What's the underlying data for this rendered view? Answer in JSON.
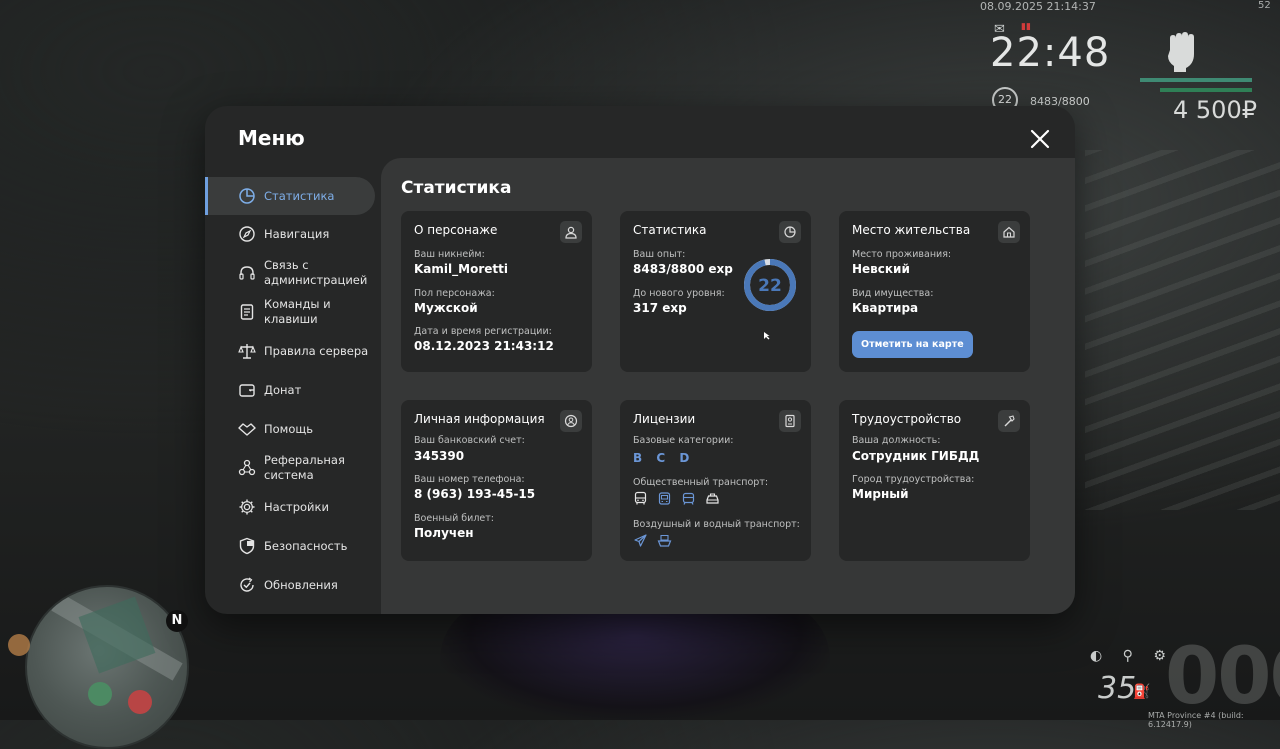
{
  "hud": {
    "datetime": "08.09.2025 21:14:37",
    "corner": "52",
    "clock": "22:48",
    "level": "22",
    "exp": "8483/8800",
    "money": "4 500₽",
    "fuel": "35",
    "build": "MTA Province #4 (build: 6.12417.9)",
    "map_north": "N",
    "colors": {
      "health": "#3f8a73",
      "armor": "#2f7f56"
    }
  },
  "menu": {
    "title": "Меню",
    "nav": [
      {
        "label": "Статистика",
        "icon": "chart-pie-icon",
        "active": true
      },
      {
        "label": "Навигация",
        "icon": "compass-icon"
      },
      {
        "label": "Связь с администрацией",
        "icon": "headset-icon"
      },
      {
        "label": "Команды и клавиши",
        "icon": "document-icon"
      },
      {
        "label": "Правила сервера",
        "icon": "scales-icon"
      },
      {
        "label": "Донат",
        "icon": "wallet-icon"
      },
      {
        "label": "Помощь",
        "icon": "handshake-icon"
      },
      {
        "label": "Реферальная система",
        "icon": "network-icon"
      },
      {
        "label": "Настройки",
        "icon": "gear-icon"
      },
      {
        "label": "Безопасность",
        "icon": "shield-icon"
      },
      {
        "label": "Обновления",
        "icon": "refresh-check-icon"
      }
    ],
    "colors": {
      "accent": "#6fa0e0",
      "button": "#5d8ed3"
    }
  },
  "content": {
    "title": "Статистика",
    "character": {
      "title": "О персонаже",
      "nickname_label": "Ваш никнейм:",
      "nickname": "Kamil_Moretti",
      "gender_label": "Пол персонажа:",
      "gender": "Мужской",
      "reg_label": "Дата и время регистрации:",
      "reg_date": "08.12.2023 21:43:12"
    },
    "stats": {
      "title": "Статистика",
      "exp_label": "Ваш опыт:",
      "exp": "8483/8800 exp",
      "next_label": "До нового уровня:",
      "next": "317 exp",
      "level": "22",
      "progress": 0.964
    },
    "residence": {
      "title": "Место жительства",
      "place_label": "Место проживания:",
      "place": "Невский",
      "type_label": "Вид имущества:",
      "type": "Квартира",
      "button": "Отметить на карте"
    },
    "personal": {
      "title": "Личная информация",
      "bank_label": "Ваш банковский счет:",
      "bank": "345390",
      "phone_label": "Ваш номер телефона:",
      "phone": "8 (963) 193-45-15",
      "military_label": "Военный билет:",
      "military": "Получен"
    },
    "licenses": {
      "title": "Лицензии",
      "base_label": "Базовые категории:",
      "base": [
        "B",
        "C",
        "D"
      ],
      "public_label": "Общественный транспорт:",
      "public_icons": [
        "bus-icon",
        "trolleybus-icon",
        "tram-icon",
        "taxi-icon"
      ],
      "air_label": "Воздушный и водный транспорт:",
      "air_icons": [
        "plane-icon",
        "boat-icon"
      ]
    },
    "employment": {
      "title": "Трудоустройство",
      "position_label": "Ваша должность:",
      "position": "Сотрудник ГИБДД",
      "city_label": "Город трудоустройства:",
      "city": "Мирный"
    }
  }
}
